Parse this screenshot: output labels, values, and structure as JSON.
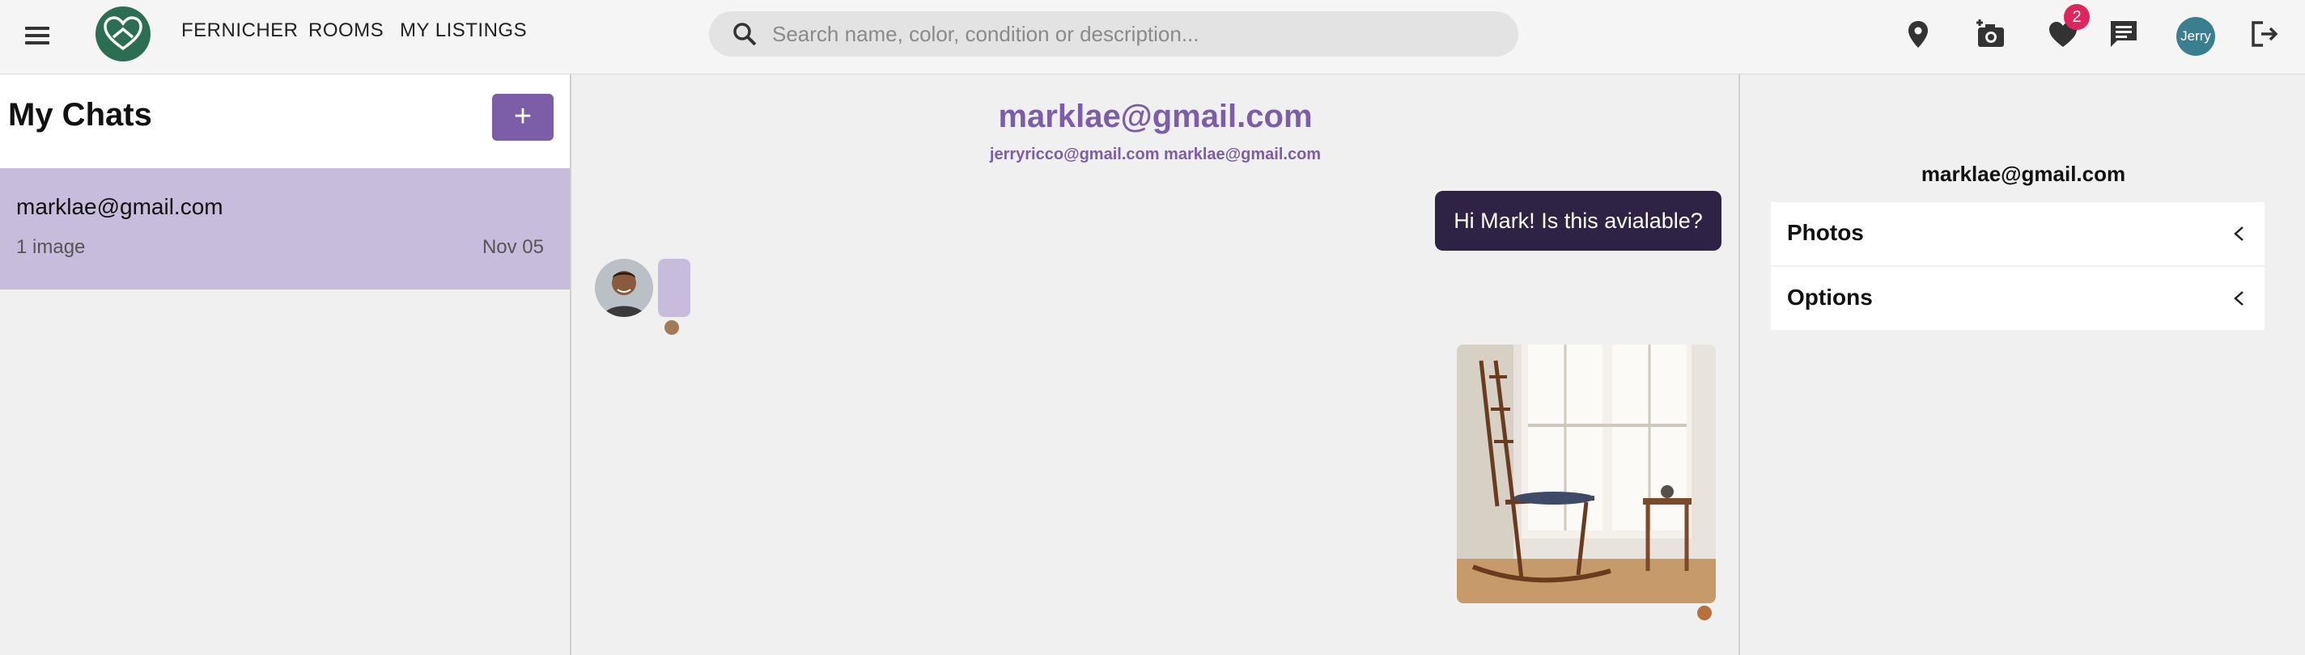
{
  "header": {
    "menu_icon": "hamburger-menu-icon",
    "logo_icon": "heart-house-logo-icon",
    "nav": [
      "FERNICHER",
      "ROOMS",
      "MY LISTINGS"
    ],
    "search_placeholder": "Search name, color, condition or description...",
    "icons": [
      "location-pin-icon",
      "add-photo-icon",
      "favorites-heart-icon",
      "chat-icon",
      "logout-icon"
    ],
    "favorites_count": "2",
    "user_label": "Jerry"
  },
  "sidebar": {
    "title": "My Chats",
    "new_chat_label": "+",
    "chats": [
      {
        "name": "marklae@gmail.com",
        "preview": "1 image",
        "date": "Nov 05"
      }
    ]
  },
  "conversation": {
    "title": "marklae@gmail.com",
    "participants": "jerryricco@gmail.com marklae@gmail.com",
    "messages": [
      {
        "direction": "outgoing",
        "text": "Hi Mark! Is this avialable?"
      },
      {
        "direction": "incoming",
        "text": ""
      },
      {
        "direction": "outgoing",
        "type": "image",
        "subject": "wooden rocking chair by window"
      }
    ]
  },
  "details": {
    "title": "marklae@gmail.com",
    "sections": [
      "Photos",
      "Options"
    ]
  },
  "colors": {
    "accent": "#7b5ea7",
    "selected_chat": "#c8bcdc",
    "outgoing_bubble": "#2e2344",
    "badge": "#e0245e",
    "logo": "#2c6e53"
  }
}
